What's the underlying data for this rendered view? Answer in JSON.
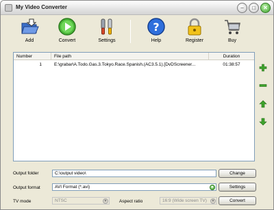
{
  "window": {
    "title": "My Video Converter"
  },
  "toolbar": {
    "add": "Add",
    "convert": "Convert",
    "settings": "Settings",
    "help": "Help",
    "register": "Register",
    "buy": "Buy"
  },
  "list": {
    "headers": {
      "number": "Number",
      "path": "File path",
      "duration": "Duration"
    },
    "rows": [
      {
        "number": "1",
        "path": "E:\\grabar\\A.Todo.Gas.3.Tokyo.Race.Spanish.(AC3.5.1).[DvDScreener...",
        "duration": "01:38:57"
      }
    ]
  },
  "form": {
    "output_folder_label": "Output folder",
    "output_folder_value": "C:\\output video\\",
    "change_button": "Change",
    "output_format_label": "Output format",
    "output_format_value": "AVI Format (*.avi)",
    "settings_button": "Settings",
    "tv_mode_label": "TV mode",
    "tv_mode_value": "NTSC",
    "aspect_ratio_label": "Aspect ratio",
    "aspect_ratio_value": "16:9  (Wide screen TV)",
    "convert_button": "Convert"
  },
  "icons": {
    "add": "folder-open-icon",
    "convert": "play-icon",
    "settings": "tools-icon",
    "help": "help-icon",
    "register": "lock-icon",
    "buy": "cart-icon",
    "side": [
      "plus-icon",
      "minus-icon",
      "arrow-up-icon",
      "arrow-down-icon"
    ]
  },
  "colors": {
    "accent_green": "#3ea32c",
    "list_border": "#7f9db9",
    "window_bg": "#ece9d8"
  }
}
